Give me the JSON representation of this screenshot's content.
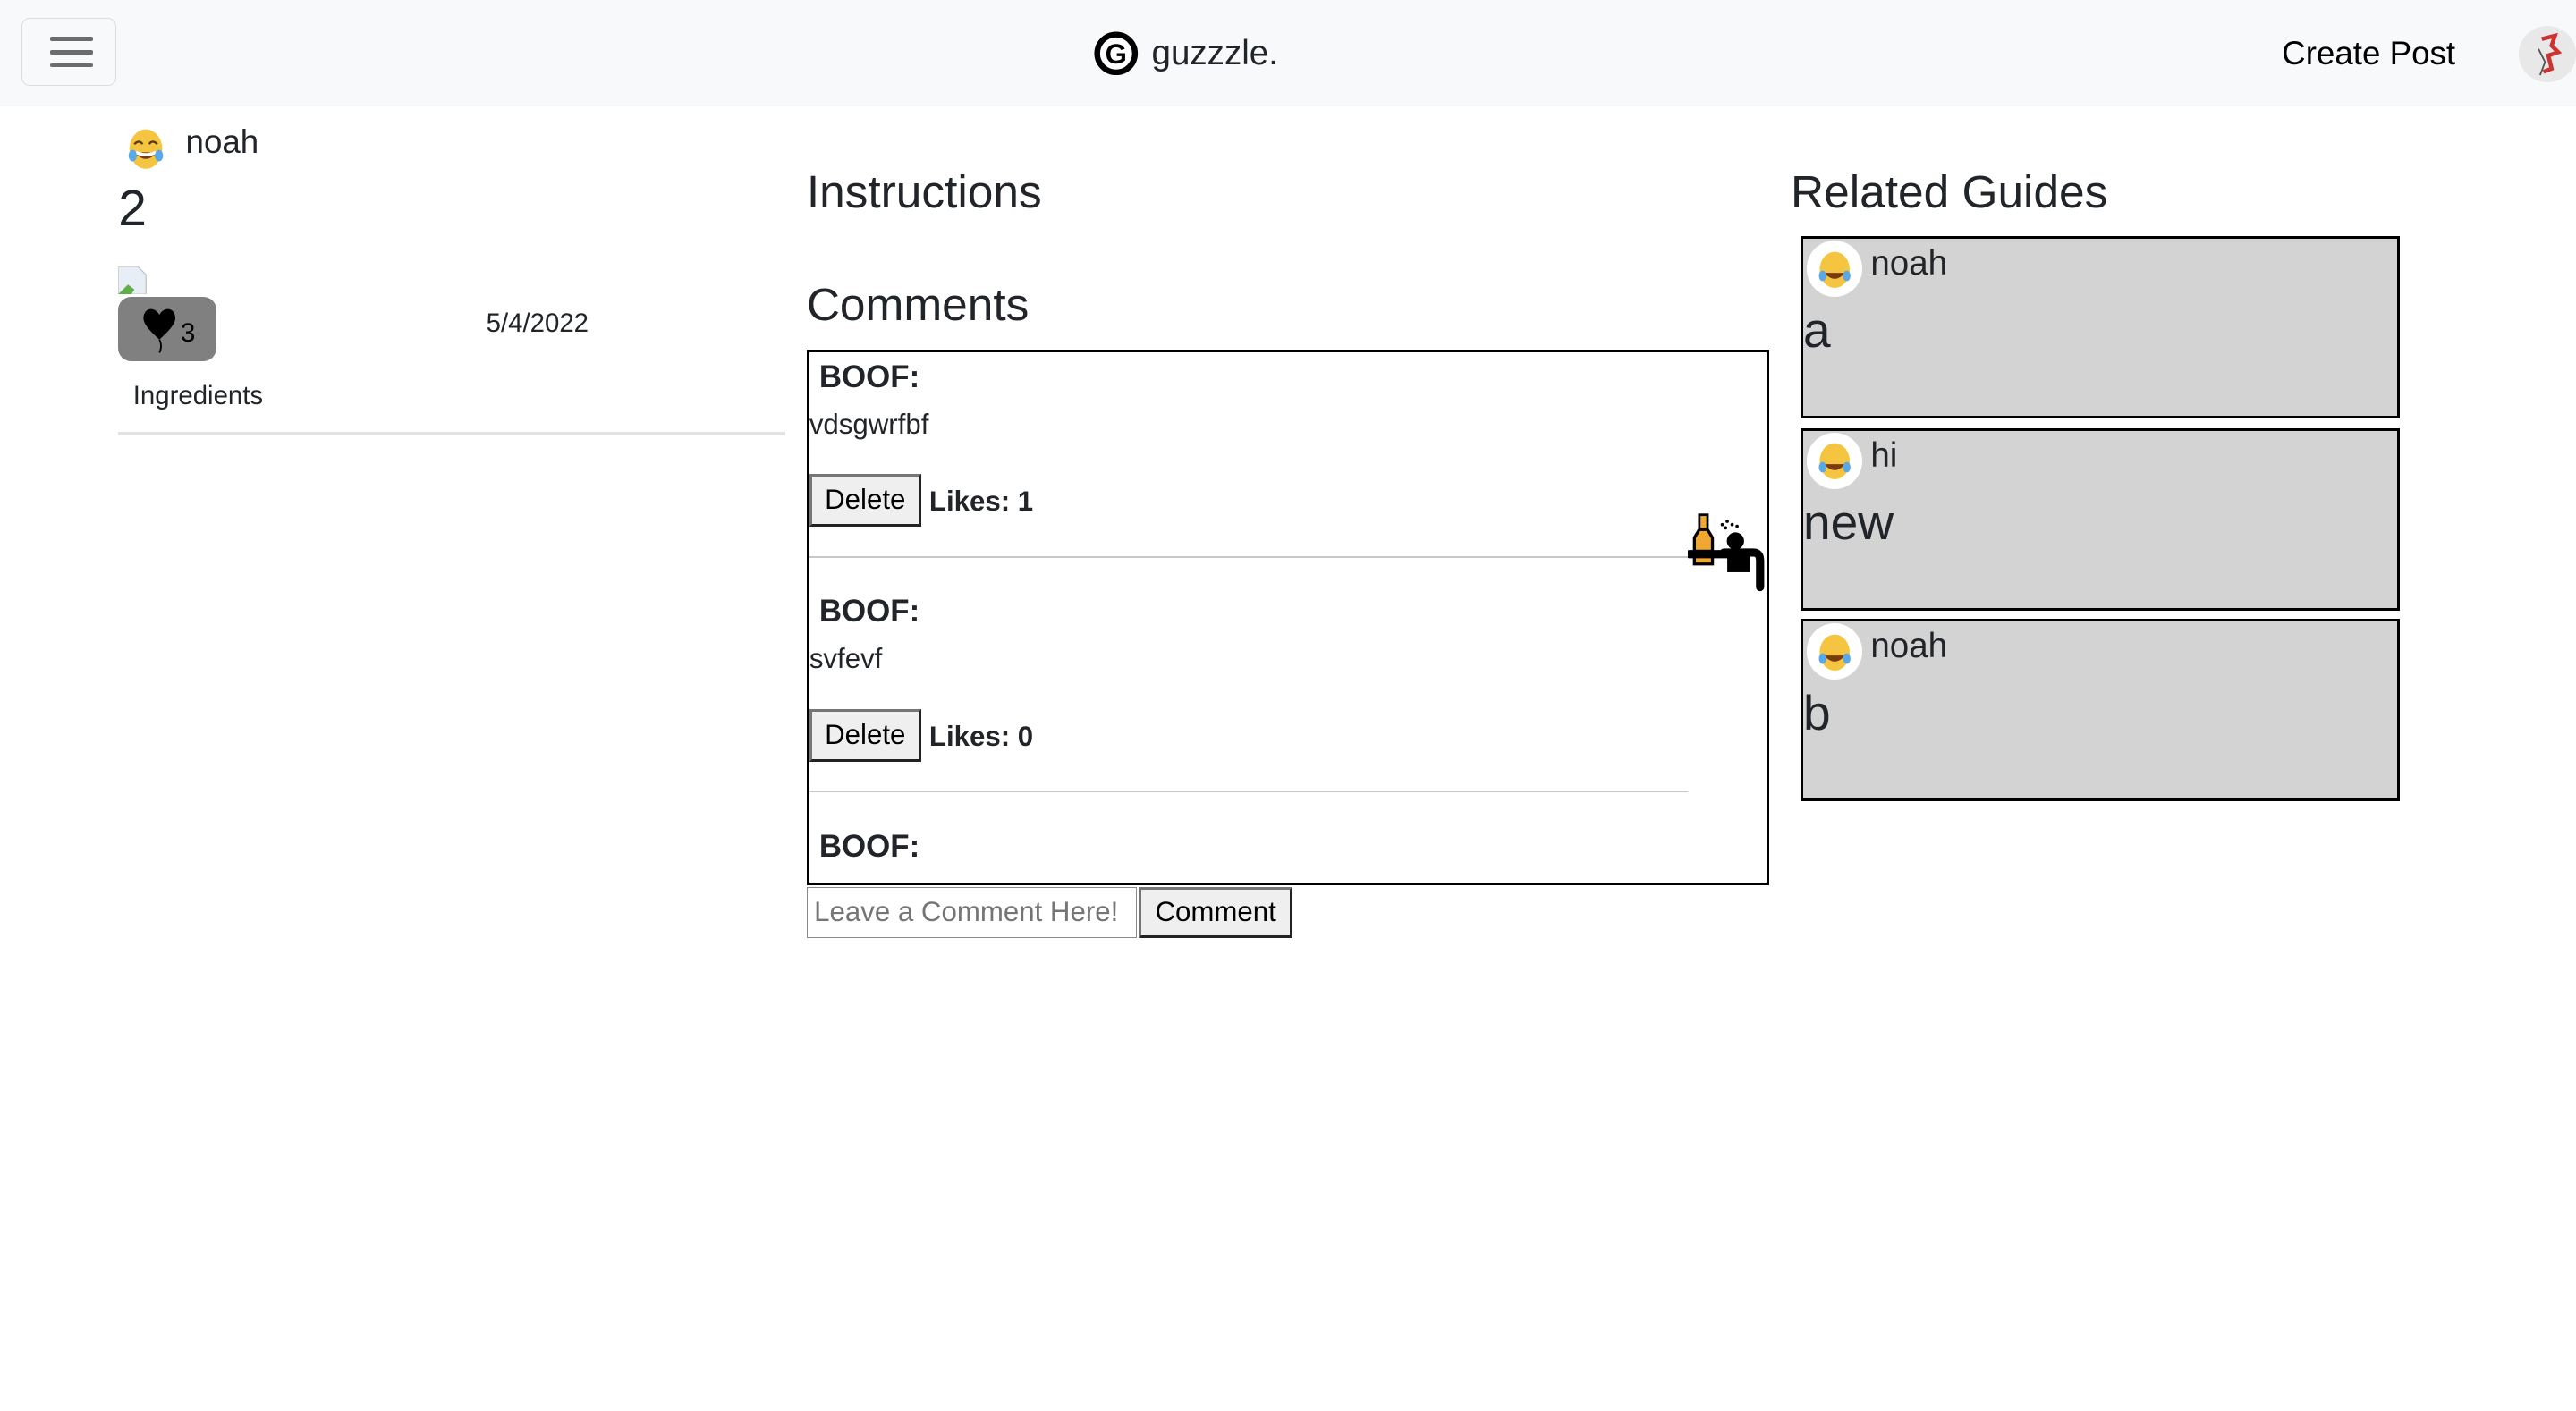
{
  "navbar": {
    "menu_icon": "hamburger-icon",
    "brand": "guzzzle.",
    "brand_icon": "g-circle-logo",
    "create_post": "Create Post",
    "profile_icon": "user-avatar"
  },
  "post": {
    "author": "noah",
    "author_icon": "laughing-tears-emoji",
    "title": "2",
    "image_icon": "broken-image-icon",
    "likes": "3",
    "like_icon": "heart-balloon-icon",
    "date": "5/4/2022",
    "ingredients_label": "Ingredients"
  },
  "instructions": {
    "heading": "Instructions"
  },
  "comments": {
    "heading": "Comments",
    "items": [
      {
        "author": "BOOF:",
        "text": "vdsgwrfbf",
        "delete": "Delete",
        "likes": "Likes: 1"
      },
      {
        "author": "BOOF:",
        "text": "svfevf",
        "delete": "Delete",
        "likes": "Likes: 0"
      },
      {
        "author": "BOOF:"
      }
    ],
    "overlay_icon": "drunk-person-bottle-icon",
    "input_placeholder": "Leave a Comment Here!",
    "submit": "Comment"
  },
  "related": {
    "heading": "Related Guides",
    "items": [
      {
        "author": "noah",
        "title": "a"
      },
      {
        "author": "hi",
        "title": "new"
      },
      {
        "author": "noah",
        "title": "b"
      }
    ]
  },
  "colors": {
    "navbar_bg": "#f8f9fa",
    "card_bg": "#d3d3d3",
    "like_bg": "#808080",
    "bottle": "#f0a830"
  }
}
